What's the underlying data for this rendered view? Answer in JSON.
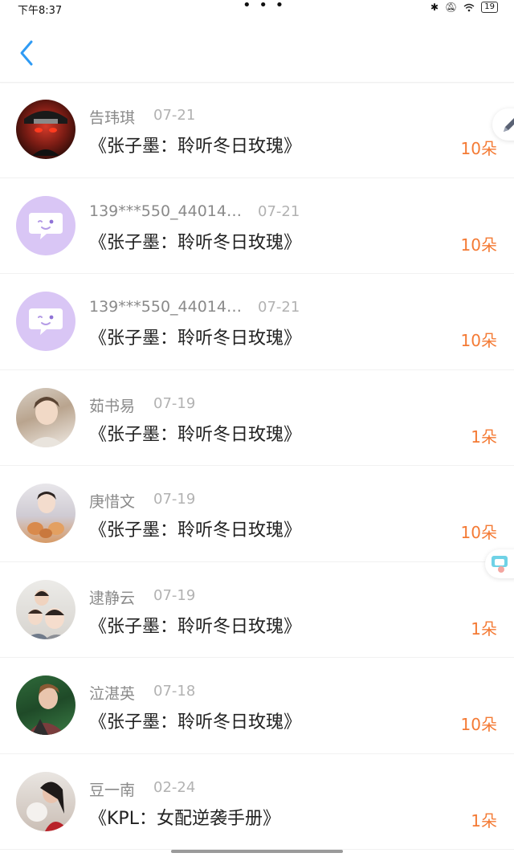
{
  "status_bar": {
    "time": "下午8:37",
    "dots": "• • •",
    "battery": "19"
  },
  "colors": {
    "accent_back": "#2f9bf4",
    "amount": "#f47a34",
    "default_avatar": "#d9c6f5"
  },
  "header": {
    "back_icon": "chevron-left-icon"
  },
  "items": [
    {
      "name": "告玮琪",
      "date": "07-21",
      "title": "《张子墨：聆听冬日玫瑰》",
      "amount": "10朵",
      "avatar": "photo"
    },
    {
      "name": "139***550_44014…",
      "date": "07-21",
      "title": "《张子墨：聆听冬日玫瑰》",
      "amount": "10朵",
      "avatar": "default"
    },
    {
      "name": "139***550_44014…",
      "date": "07-21",
      "title": "《张子墨：聆听冬日玫瑰》",
      "amount": "10朵",
      "avatar": "default"
    },
    {
      "name": "茹书易",
      "date": "07-19",
      "title": "《张子墨：聆听冬日玫瑰》",
      "amount": "1朵",
      "avatar": "photo"
    },
    {
      "name": "庚惜文",
      "date": "07-19",
      "title": "《张子墨：聆听冬日玫瑰》",
      "amount": "10朵",
      "avatar": "photo"
    },
    {
      "name": "逮静云",
      "date": "07-19",
      "title": "《张子墨：聆听冬日玫瑰》",
      "amount": "1朵",
      "avatar": "photo"
    },
    {
      "name": "泣湛英",
      "date": "07-18",
      "title": "《张子墨：聆听冬日玫瑰》",
      "amount": "10朵",
      "avatar": "photo"
    },
    {
      "name": "豆一南",
      "date": "02-24",
      "title": "《KPL：女配逆袭手册》",
      "amount": "1朵",
      "avatar": "photo"
    }
  ]
}
